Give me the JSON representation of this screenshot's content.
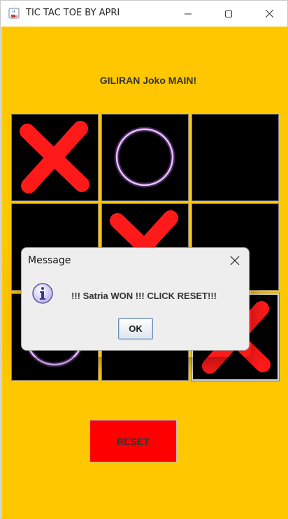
{
  "window": {
    "title": "TIC TAC TOE BY APRI",
    "icons": {
      "app": "java-cup-icon",
      "minimize": "minimize-icon",
      "maximize": "maximize-icon",
      "close": "close-icon"
    }
  },
  "game": {
    "turn_label": "GILIRAN Joko MAIN!",
    "board": [
      [
        "X",
        "O",
        ""
      ],
      [
        "",
        "X",
        ""
      ],
      [
        "O",
        "",
        "X"
      ]
    ],
    "colors": {
      "background": "#ffc700",
      "cell": "#000000",
      "x_mark": "#ff1a1a",
      "o_mark": "#c56bff"
    }
  },
  "reset": {
    "label": "RESET",
    "color": "#ff0000"
  },
  "dialog": {
    "title": "Message",
    "message": "!!! Satria WON !!! CLICK RESET!!!",
    "ok_label": "OK",
    "icon": "info-icon"
  }
}
